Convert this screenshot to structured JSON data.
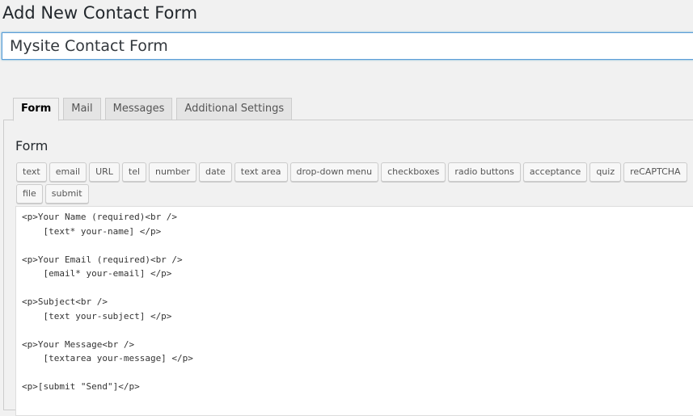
{
  "page": {
    "title": "Add New Contact Form"
  },
  "title_field": {
    "value": "Mysite Contact Form"
  },
  "tabs": [
    {
      "label": "Form",
      "active": true
    },
    {
      "label": "Mail",
      "active": false
    },
    {
      "label": "Messages",
      "active": false
    },
    {
      "label": "Additional Settings",
      "active": false
    }
  ],
  "form_panel": {
    "heading": "Form",
    "tag_buttons": [
      "text",
      "email",
      "URL",
      "tel",
      "number",
      "date",
      "text area",
      "drop-down menu",
      "checkboxes",
      "radio buttons",
      "acceptance",
      "quiz",
      "reCAPTCHA",
      "file",
      "submit"
    ],
    "code": "<p>Your Name (required)<br />\n    [text* your-name] </p>\n\n<p>Your Email (required)<br />\n    [email* your-email] </p>\n\n<p>Subject<br />\n    [text your-subject] </p>\n\n<p>Your Message<br />\n    [textarea your-message] </p>\n\n<p>[submit \"Send\"]</p>"
  },
  "colors": {
    "background": "#f1f1f1",
    "input_focus_border": "#5b9dd9",
    "tab_inactive": "#e4e4e4",
    "text": "#23282d"
  }
}
